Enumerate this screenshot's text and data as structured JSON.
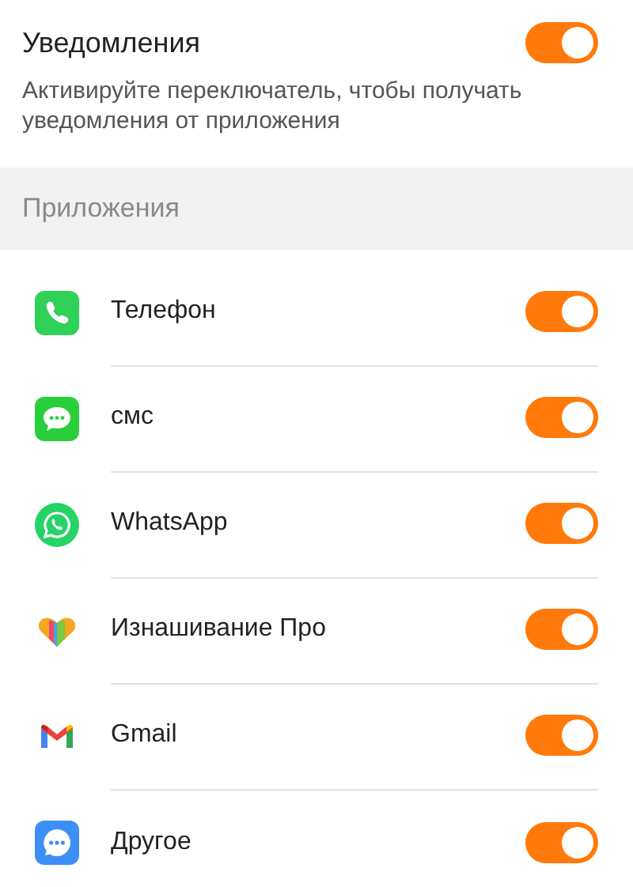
{
  "notifications": {
    "title": "Уведомления",
    "description": "Активируйте переключатель, чтобы получать уведомления от приложения",
    "on": true
  },
  "section_title": "Приложения",
  "apps": [
    {
      "name": "Телефон",
      "kind": "phone",
      "on": true
    },
    {
      "name": "смс",
      "kind": "message",
      "on": true
    },
    {
      "name": "WhatsApp",
      "kind": "chat",
      "on": true
    },
    {
      "name": "Изнашивание Про",
      "kind": "heart",
      "on": true
    },
    {
      "name": "Gmail",
      "kind": "mail",
      "on": true
    },
    {
      "name": "Другое",
      "kind": "dots",
      "on": true
    }
  ]
}
